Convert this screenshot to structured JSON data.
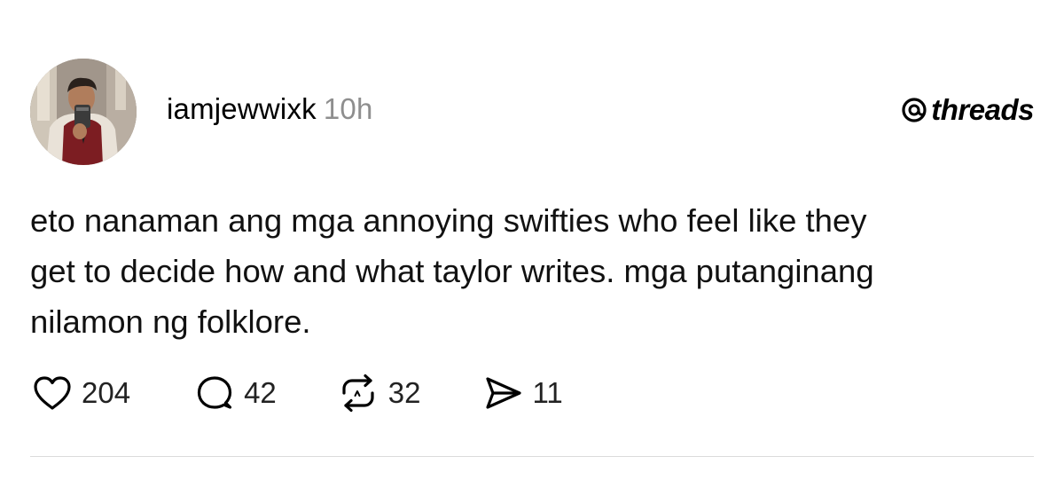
{
  "post": {
    "author": {
      "username": "iamjewwixk",
      "time": "10h"
    },
    "brand": {
      "label": "threads",
      "icon": "threads-logo-icon"
    },
    "text": "eto nanaman ang mga annoying swifties who feel like they\nget to decide how and what taylor writes. mga putanginang\nnilamon ng folklore.",
    "actions": {
      "likes": {
        "icon": "heart-icon",
        "count": "204"
      },
      "replies": {
        "icon": "comment-icon",
        "count": "42"
      },
      "reposts": {
        "icon": "repost-icon",
        "count": "32"
      },
      "shares": {
        "icon": "send-icon",
        "count": "11"
      }
    }
  }
}
